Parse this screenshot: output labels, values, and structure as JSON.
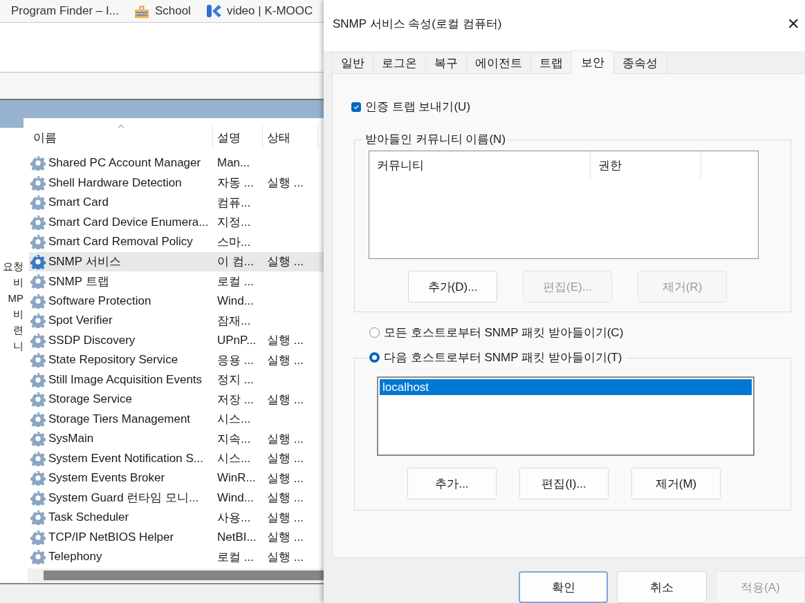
{
  "browser_bookmarks": [
    {
      "label": "Program Finder – I...",
      "kind": "text"
    },
    {
      "label": "School",
      "kind": "building"
    },
    {
      "label": "video | K-MOOC",
      "kind": "k-logo"
    }
  ],
  "services_window": {
    "side_fragments": [
      "요청",
      "비",
      "MP",
      "비",
      "련",
      "니"
    ],
    "columns": [
      {
        "label": "이름",
        "sorted": true
      },
      {
        "label": "설명",
        "sorted": false
      },
      {
        "label": "상태",
        "sorted": false
      }
    ],
    "rows": [
      {
        "name": "Shared PC Account Manager",
        "description": "Man...",
        "status": "",
        "selected": false
      },
      {
        "name": "Shell Hardware Detection",
        "description": "자동 ...",
        "status": "실행 ...",
        "selected": false
      },
      {
        "name": "Smart Card",
        "description": "컴퓨...",
        "status": "",
        "selected": false
      },
      {
        "name": "Smart Card Device Enumera...",
        "description": "지정...",
        "status": "",
        "selected": false
      },
      {
        "name": "Smart Card Removal Policy",
        "description": "스마...",
        "status": "",
        "selected": false
      },
      {
        "name": "SNMP 서비스",
        "description": "이 컴...",
        "status": "실행 ...",
        "selected": true
      },
      {
        "name": "SNMP 트랩",
        "description": "로컬 ...",
        "status": "",
        "selected": false
      },
      {
        "name": "Software Protection",
        "description": "Wind...",
        "status": "",
        "selected": false
      },
      {
        "name": "Spot Verifier",
        "description": "잠재...",
        "status": "",
        "selected": false
      },
      {
        "name": "SSDP Discovery",
        "description": "UPnP...",
        "status": "실행 ...",
        "selected": false
      },
      {
        "name": "State Repository Service",
        "description": "응용 ...",
        "status": "실행 ...",
        "selected": false
      },
      {
        "name": "Still Image Acquisition Events",
        "description": "정지 ...",
        "status": "",
        "selected": false
      },
      {
        "name": "Storage Service",
        "description": "저장 ...",
        "status": "실행 ...",
        "selected": false
      },
      {
        "name": "Storage Tiers Management",
        "description": "시스...",
        "status": "",
        "selected": false
      },
      {
        "name": "SysMain",
        "description": "지속...",
        "status": "실행 ...",
        "selected": false
      },
      {
        "name": "System Event Notification S...",
        "description": "시스...",
        "status": "실행 ...",
        "selected": false
      },
      {
        "name": "System Events Broker",
        "description": "WinR...",
        "status": "실행 ...",
        "selected": false
      },
      {
        "name": "System Guard 런타임 모니...",
        "description": "Wind...",
        "status": "실행 ...",
        "selected": false
      },
      {
        "name": "Task Scheduler",
        "description": "사용...",
        "status": "실행 ...",
        "selected": false
      },
      {
        "name": "TCP/IP NetBIOS Helper",
        "description": "NetBI...",
        "status": "실행 ...",
        "selected": false
      },
      {
        "name": "Telephony",
        "description": "로컬 ...",
        "status": "실행 ...",
        "selected": false
      }
    ]
  },
  "dialog": {
    "title": "SNMP 서비스 속성(로컬 컴퓨터)",
    "close": "×",
    "tabs": [
      {
        "label": "일반",
        "selected": false
      },
      {
        "label": "로그온",
        "selected": false
      },
      {
        "label": "복구",
        "selected": false
      },
      {
        "label": "에이전트",
        "selected": false
      },
      {
        "label": "트랩",
        "selected": false
      },
      {
        "label": "보안",
        "selected": true
      },
      {
        "label": "종속성",
        "selected": false
      }
    ],
    "send_auth_trap": {
      "label": "인증 트랩 보내기(U)",
      "checked": true
    },
    "communities": {
      "title": "받아들인 커뮤니티 이름(N)",
      "columns": [
        "커뮤니티",
        "권한"
      ],
      "buttons": [
        {
          "label": "추가(D)...",
          "disabled": false
        },
        {
          "label": "편집(E)...",
          "disabled": true
        },
        {
          "label": "제거(R)",
          "disabled": true
        }
      ]
    },
    "accept_options": [
      {
        "label": "모든 호스트로부터 SNMP 패킷 받아들이기(C)",
        "selected": false
      },
      {
        "label": "다음 호스트로부터 SNMP 패킷 받아들이기(T)",
        "selected": true
      }
    ],
    "hosts": {
      "items": [
        {
          "label": "localhost",
          "selected": true
        }
      ],
      "buttons": [
        {
          "label": "추가...",
          "disabled": false
        },
        {
          "label": "편집(I)...",
          "disabled": false
        },
        {
          "label": "제거(M)",
          "disabled": false
        }
      ]
    },
    "footer_buttons": [
      {
        "label": "확인",
        "disabled": false,
        "default": true
      },
      {
        "label": "취소",
        "disabled": false,
        "default": false
      },
      {
        "label": "적용(A)",
        "disabled": true,
        "default": false
      }
    ]
  }
}
